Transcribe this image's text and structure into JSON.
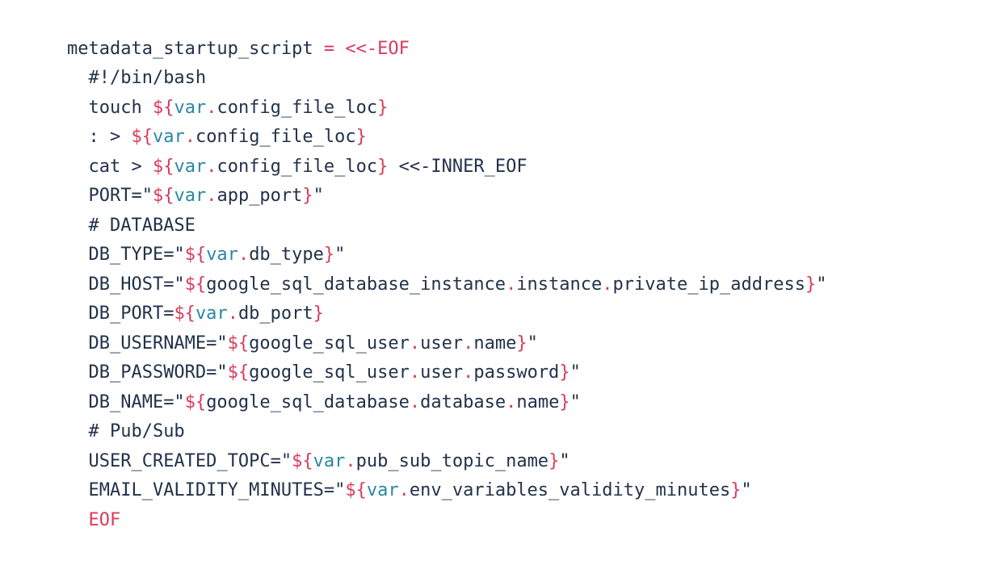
{
  "colors": {
    "plain": "#22324a",
    "accent_red": "#d93c5b",
    "accent_blue": "#2a86a3"
  },
  "code": {
    "lines": [
      [
        {
          "t": "metadata_startup_script ",
          "c": "plain"
        },
        {
          "t": "= <<-EOF",
          "c": "red"
        }
      ],
      [
        {
          "t": "  #!/bin/bash",
          "c": "plain"
        }
      ],
      [
        {
          "t": "  touch ",
          "c": "plain"
        },
        {
          "t": "${",
          "c": "red"
        },
        {
          "t": "var",
          "c": "blue"
        },
        {
          "t": ".",
          "c": "red"
        },
        {
          "t": "config_file_loc",
          "c": "plain"
        },
        {
          "t": "}",
          "c": "red"
        }
      ],
      [
        {
          "t": "  : > ",
          "c": "plain"
        },
        {
          "t": "${",
          "c": "red"
        },
        {
          "t": "var",
          "c": "blue"
        },
        {
          "t": ".",
          "c": "red"
        },
        {
          "t": "config_file_loc",
          "c": "plain"
        },
        {
          "t": "}",
          "c": "red"
        }
      ],
      [
        {
          "t": "  cat > ",
          "c": "plain"
        },
        {
          "t": "${",
          "c": "red"
        },
        {
          "t": "var",
          "c": "blue"
        },
        {
          "t": ".",
          "c": "red"
        },
        {
          "t": "config_file_loc",
          "c": "plain"
        },
        {
          "t": "}",
          "c": "red"
        },
        {
          "t": " <<-INNER_EOF",
          "c": "plain"
        }
      ],
      [
        {
          "t": "  PORT=\"",
          "c": "plain"
        },
        {
          "t": "${",
          "c": "red"
        },
        {
          "t": "var",
          "c": "blue"
        },
        {
          "t": ".",
          "c": "red"
        },
        {
          "t": "app_port",
          "c": "plain"
        },
        {
          "t": "}",
          "c": "red"
        },
        {
          "t": "\"",
          "c": "plain"
        }
      ],
      [
        {
          "t": "  # DATABASE",
          "c": "plain"
        }
      ],
      [
        {
          "t": "  DB_TYPE=\"",
          "c": "plain"
        },
        {
          "t": "${",
          "c": "red"
        },
        {
          "t": "var",
          "c": "blue"
        },
        {
          "t": ".",
          "c": "red"
        },
        {
          "t": "db_type",
          "c": "plain"
        },
        {
          "t": "}",
          "c": "red"
        },
        {
          "t": "\"",
          "c": "plain"
        }
      ],
      [
        {
          "t": "  DB_HOST=\"",
          "c": "plain"
        },
        {
          "t": "${",
          "c": "red"
        },
        {
          "t": "google_sql_database_instance",
          "c": "plain"
        },
        {
          "t": ".",
          "c": "red"
        },
        {
          "t": "instance",
          "c": "plain"
        },
        {
          "t": ".",
          "c": "red"
        },
        {
          "t": "private_ip_address",
          "c": "plain"
        },
        {
          "t": "}",
          "c": "red"
        },
        {
          "t": "\"",
          "c": "plain"
        }
      ],
      [
        {
          "t": "  DB_PORT=",
          "c": "plain"
        },
        {
          "t": "${",
          "c": "red"
        },
        {
          "t": "var",
          "c": "blue"
        },
        {
          "t": ".",
          "c": "red"
        },
        {
          "t": "db_port",
          "c": "plain"
        },
        {
          "t": "}",
          "c": "red"
        }
      ],
      [
        {
          "t": "  DB_USERNAME=\"",
          "c": "plain"
        },
        {
          "t": "${",
          "c": "red"
        },
        {
          "t": "google_sql_user",
          "c": "plain"
        },
        {
          "t": ".",
          "c": "red"
        },
        {
          "t": "user",
          "c": "plain"
        },
        {
          "t": ".",
          "c": "red"
        },
        {
          "t": "name",
          "c": "plain"
        },
        {
          "t": "}",
          "c": "red"
        },
        {
          "t": "\"",
          "c": "plain"
        }
      ],
      [
        {
          "t": "  DB_PASSWORD=\"",
          "c": "plain"
        },
        {
          "t": "${",
          "c": "red"
        },
        {
          "t": "google_sql_user",
          "c": "plain"
        },
        {
          "t": ".",
          "c": "red"
        },
        {
          "t": "user",
          "c": "plain"
        },
        {
          "t": ".",
          "c": "red"
        },
        {
          "t": "password",
          "c": "plain"
        },
        {
          "t": "}",
          "c": "red"
        },
        {
          "t": "\"",
          "c": "plain"
        }
      ],
      [
        {
          "t": "  DB_NAME=\"",
          "c": "plain"
        },
        {
          "t": "${",
          "c": "red"
        },
        {
          "t": "google_sql_database",
          "c": "plain"
        },
        {
          "t": ".",
          "c": "red"
        },
        {
          "t": "database",
          "c": "plain"
        },
        {
          "t": ".",
          "c": "red"
        },
        {
          "t": "name",
          "c": "plain"
        },
        {
          "t": "}",
          "c": "red"
        },
        {
          "t": "\"",
          "c": "plain"
        }
      ],
      [
        {
          "t": "  # Pub/Sub",
          "c": "plain"
        }
      ],
      [
        {
          "t": "  USER_CREATED_TOPC=\"",
          "c": "plain"
        },
        {
          "t": "${",
          "c": "red"
        },
        {
          "t": "var",
          "c": "blue"
        },
        {
          "t": ".",
          "c": "red"
        },
        {
          "t": "pub_sub_topic_name",
          "c": "plain"
        },
        {
          "t": "}",
          "c": "red"
        },
        {
          "t": "\"",
          "c": "plain"
        }
      ],
      [
        {
          "t": "  EMAIL_VALIDITY_MINUTES=\"",
          "c": "plain"
        },
        {
          "t": "${",
          "c": "red"
        },
        {
          "t": "var",
          "c": "blue"
        },
        {
          "t": ".",
          "c": "red"
        },
        {
          "t": "env_variables_validity_minutes",
          "c": "plain"
        },
        {
          "t": "}",
          "c": "red"
        },
        {
          "t": "\"",
          "c": "plain"
        }
      ],
      [
        {
          "t": "  EOF",
          "c": "red"
        }
      ]
    ]
  }
}
